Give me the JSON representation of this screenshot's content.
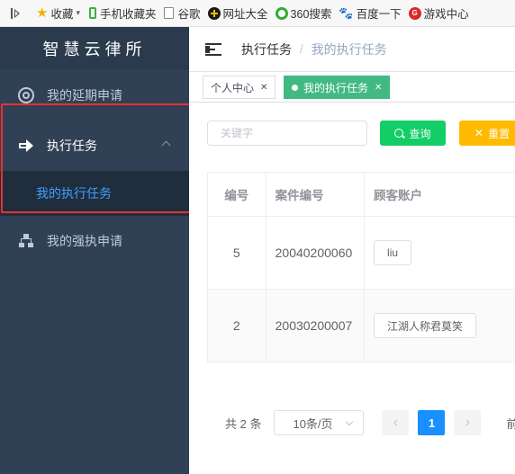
{
  "bookmarks": {
    "items": [
      {
        "label": "收藏",
        "icon": "star-icon"
      },
      {
        "label": "手机收藏夹",
        "icon": "phone-icon"
      },
      {
        "label": "谷歌",
        "icon": "document-icon"
      },
      {
        "label": "网址大全",
        "icon": "plus-circle-icon"
      },
      {
        "label": "360搜索",
        "icon": "360-icon"
      },
      {
        "label": "百度一下",
        "icon": "paw-icon"
      },
      {
        "label": "游戏中心",
        "icon": "game-icon"
      }
    ],
    "game_badge": "G"
  },
  "sidebar": {
    "brand": "智慧云律所",
    "items": [
      {
        "label": "我的延期申请",
        "icon": "target-icon"
      },
      {
        "label": "执行任务",
        "icon": "arrow-right-icon"
      },
      {
        "label": "我的强执申请",
        "icon": "sitemap-icon"
      }
    ],
    "submenu_label": "我的执行任务"
  },
  "navbar": {
    "breadcrumb": [
      "执行任务",
      "我的执行任务"
    ],
    "separator": "/"
  },
  "tags": [
    {
      "label": "个人中心",
      "active": false
    },
    {
      "label": "我的执行任务",
      "active": true
    }
  ],
  "search": {
    "placeholder": "关键字",
    "query_label": "查询",
    "reset_label": "重置"
  },
  "table": {
    "headers": [
      "编号",
      "案件编号",
      "顾客账户"
    ],
    "rows": [
      {
        "id": "5",
        "case_no": "20040200060",
        "account": "liu"
      },
      {
        "id": "2",
        "case_no": "20030200007",
        "account": "江湖人称君莫笑"
      }
    ]
  },
  "pagination": {
    "total": "共 2 条",
    "page_size": "10条/页",
    "prev": "‹",
    "current_page": "1",
    "next": "›",
    "jump_label": "前"
  },
  "colors": {
    "sidebar_bg": "#304156",
    "active_tag": "#42b983",
    "query_button": "#13ce66",
    "reset_button": "#ffba00",
    "current_page": "#1890ff",
    "highlight_box": "#e8312f"
  }
}
